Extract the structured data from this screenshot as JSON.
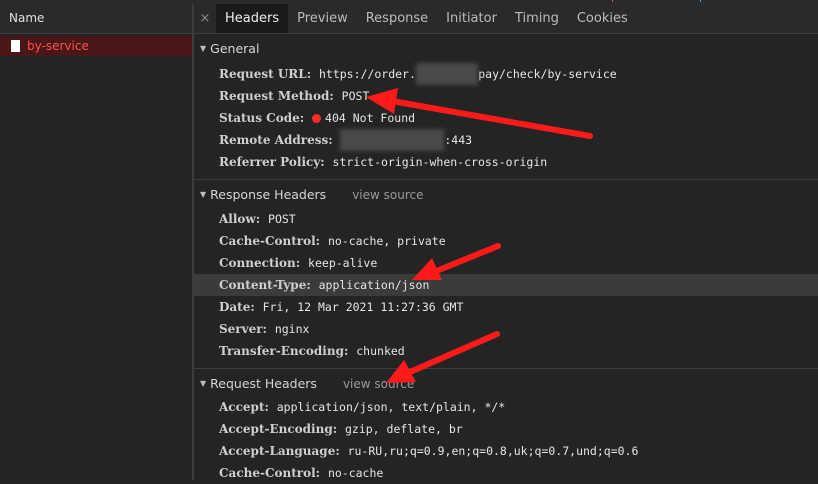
{
  "left_pane": {
    "header": "Name",
    "requests": [
      {
        "name": "by-service"
      }
    ]
  },
  "tabs": {
    "close": "×",
    "items": [
      "Headers",
      "Preview",
      "Response",
      "Initiator",
      "Timing",
      "Cookies"
    ],
    "active": "Headers"
  },
  "general": {
    "title": "General",
    "request_url_key": "Request URL:",
    "request_url_prefix": "https://order.",
    "request_url_suffix": "pay/check/by-service",
    "request_method_key": "Request Method:",
    "request_method": "POST",
    "status_code_key": "Status Code:",
    "status_code": "404 Not Found",
    "remote_address_key": "Remote Address:",
    "remote_address_suffix": ":443",
    "referrer_policy_key": "Referrer Policy:",
    "referrer_policy": "strict-origin-when-cross-origin"
  },
  "response_headers": {
    "title": "Response Headers",
    "view_source": "view source",
    "rows": [
      {
        "key": "Allow:",
        "value": "POST"
      },
      {
        "key": "Cache-Control:",
        "value": "no-cache, private"
      },
      {
        "key": "Connection:",
        "value": "keep-alive"
      },
      {
        "key": "Content-Type:",
        "value": "application/json"
      },
      {
        "key": "Date:",
        "value": "Fri, 12 Mar 2021 11:27:36 GMT"
      },
      {
        "key": "Server:",
        "value": "nginx"
      },
      {
        "key": "Transfer-Encoding:",
        "value": "chunked"
      }
    ]
  },
  "request_headers": {
    "title": "Request Headers",
    "view_source": "view source",
    "rows": [
      {
        "key": "Accept:",
        "value": "application/json, text/plain, */*"
      },
      {
        "key": "Accept-Encoding:",
        "value": "gzip, deflate, br"
      },
      {
        "key": "Accept-Language:",
        "value": "ru-RU,ru;q=0.9,en;q=0.8,uk;q=0.7,und;q=0.6"
      },
      {
        "key": "Cache-Control:",
        "value": "no-cache"
      }
    ]
  },
  "colors": {
    "background": "#242424",
    "selected_request": "#4a1717",
    "error_text": "#ff5050",
    "status_dot": "#ff2b2b",
    "annotation_arrow": "#ff1a1a"
  }
}
